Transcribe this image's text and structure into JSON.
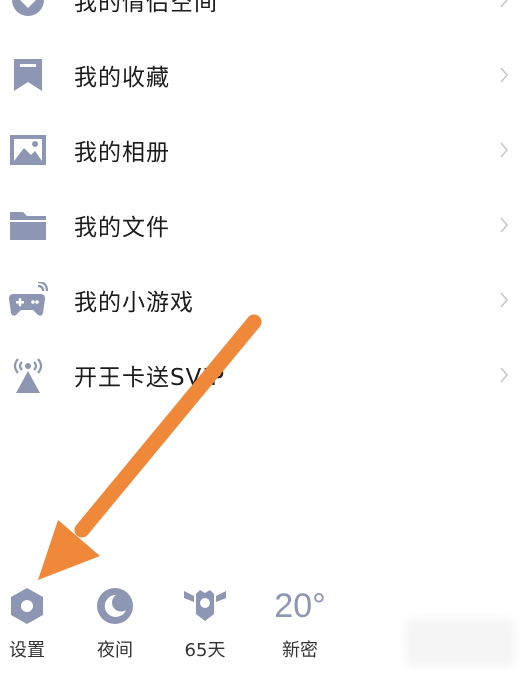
{
  "colors": {
    "icon": "#8d96b2",
    "chevron": "#c8c8c8",
    "arrow": "#f0883a",
    "text": "#1c1c1c"
  },
  "menu": {
    "items": [
      {
        "label": "我的情侣空间",
        "icon": "heart-icon"
      },
      {
        "label": "我的收藏",
        "icon": "bookmark-icon"
      },
      {
        "label": "我的相册",
        "icon": "photo-icon"
      },
      {
        "label": "我的文件",
        "icon": "folder-icon"
      },
      {
        "label": "我的小游戏",
        "icon": "gamepad-icon"
      },
      {
        "label": "开王卡送SVIP",
        "icon": "broadcast-icon"
      }
    ]
  },
  "bottom_bar": {
    "settings_label": "设置",
    "night_label": "夜间",
    "days_label": "65天",
    "weather_temp": "20°",
    "weather_label": "新密"
  }
}
